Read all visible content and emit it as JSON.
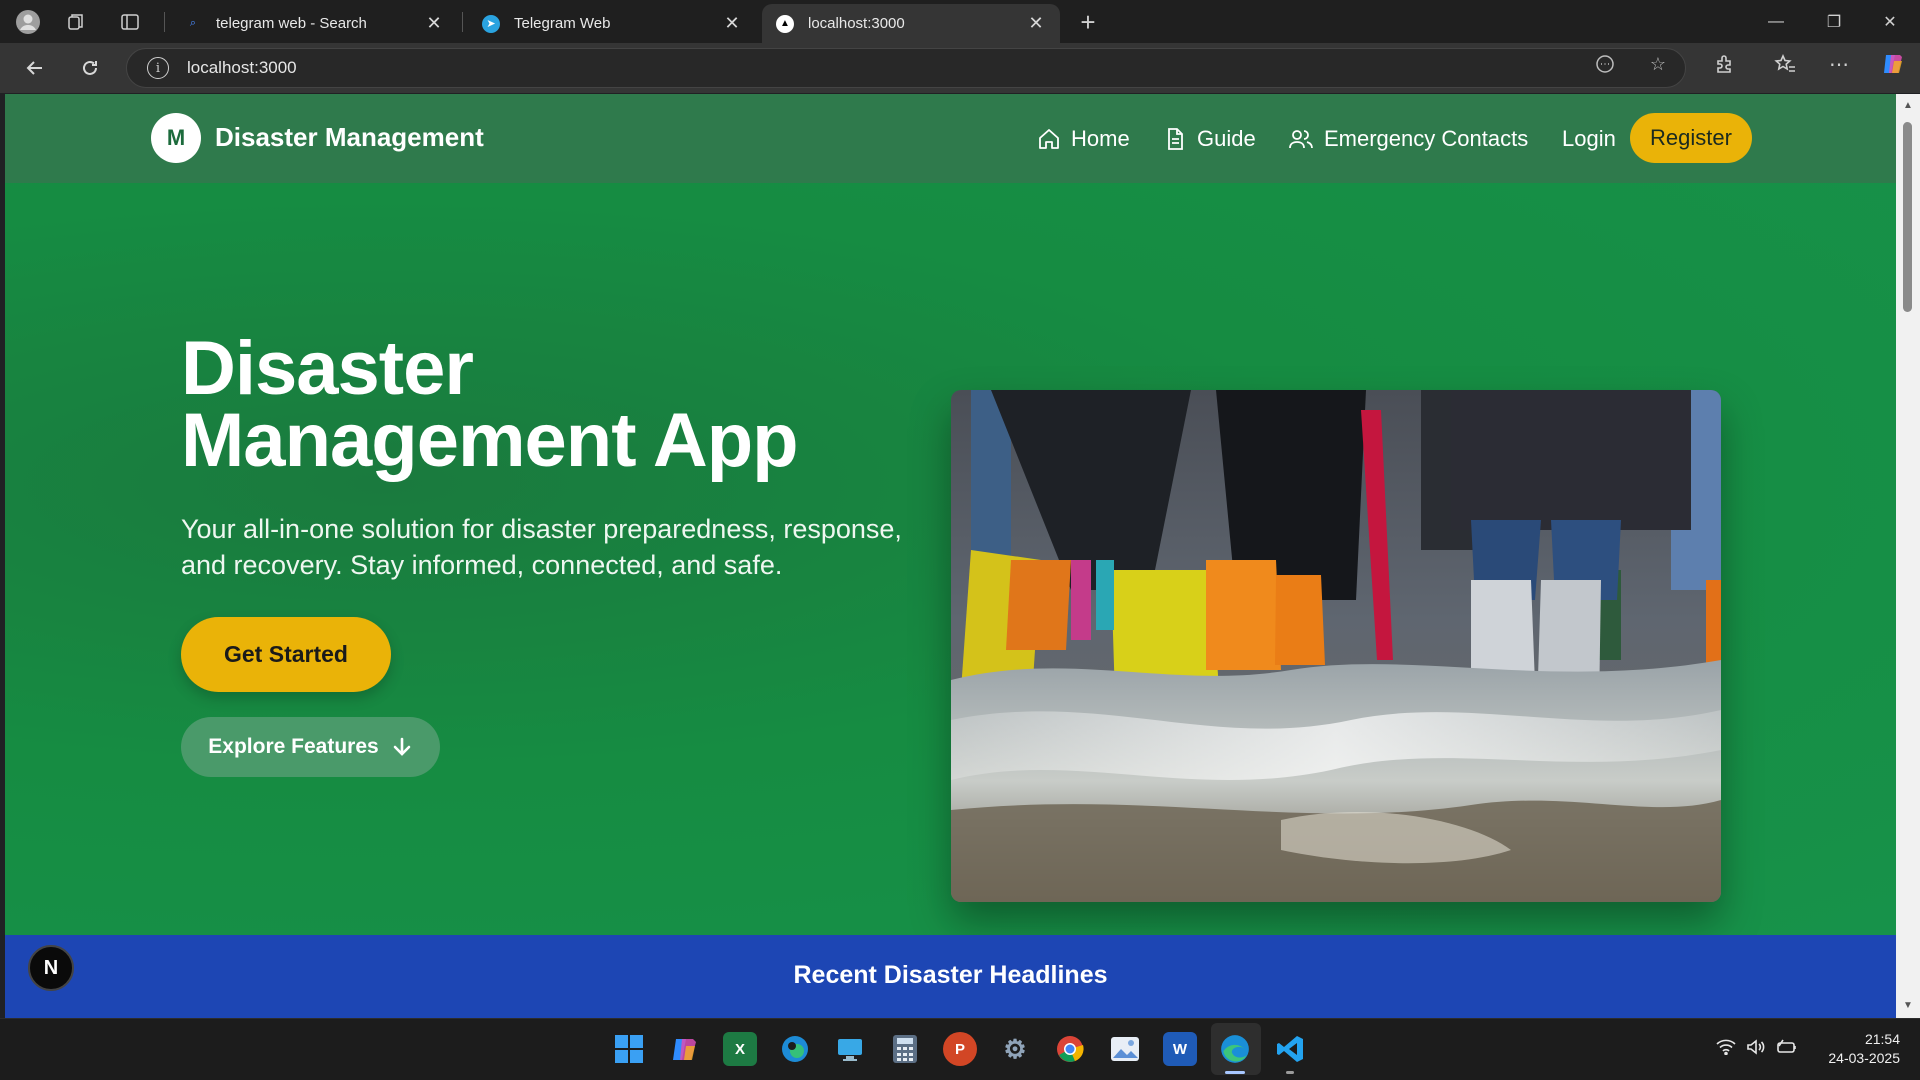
{
  "browser": {
    "tabs": [
      {
        "title": "telegram web - Search",
        "active": false
      },
      {
        "title": "Telegram Web",
        "active": false
      },
      {
        "title": "localhost:3000",
        "active": true
      }
    ],
    "new_tab": "+",
    "url": "localhost:3000"
  },
  "site": {
    "logo_letter": "M",
    "brand": "Disaster Management",
    "nav": {
      "home": "Home",
      "guide": "Guide",
      "contacts": "Emergency Contacts",
      "login": "Login",
      "register": "Register"
    }
  },
  "hero": {
    "title_line1": "Disaster",
    "title_line2": "Management App",
    "subtitle": "Your all-in-one solution for disaster preparedness, response, and recovery. Stay informed, connected, and safe.",
    "cta_primary": "Get Started",
    "cta_secondary": "Explore Features"
  },
  "headlines": {
    "title": "Recent Disaster Headlines"
  },
  "dev_badge": "N",
  "taskbar": {
    "time": "21:54",
    "date": "24-03-2025"
  },
  "colors": {
    "header_green": "#2f7a4c",
    "hero_green": "#168c42",
    "accent_yellow": "#eab308",
    "headlines_blue": "#1d46b4"
  }
}
